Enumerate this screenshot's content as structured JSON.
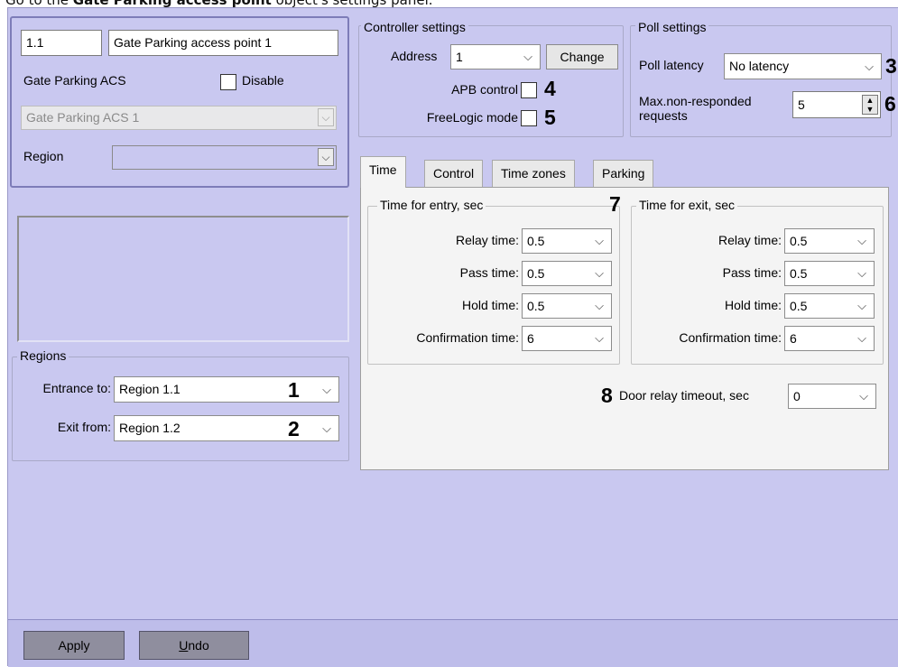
{
  "caption": {
    "prefix": "Go to the ",
    "bold": "Gate Parking access point",
    "suffix": " object's settings panel."
  },
  "object": {
    "id": "1.1",
    "name": "Gate Parking access point 1",
    "parent_label": "Gate Parking ACS",
    "disable_label": "Disable",
    "parent_value": "Gate Parking ACS 1",
    "region_label": "Region",
    "region_value": ""
  },
  "regions": {
    "legend": "Regions",
    "entrance_label": "Entrance to:",
    "entrance_value": "Region 1.1",
    "entrance_marker": "1",
    "exit_label": "Exit from:",
    "exit_value": "Region 1.2",
    "exit_marker": "2"
  },
  "controller": {
    "legend": "Controller settings",
    "address_label": "Address",
    "address_value": "1",
    "change_button": "Change",
    "apb_label": "APB control",
    "apb_marker": "4",
    "freelogic_label": "FreeLogic mode",
    "freelogic_marker": "5"
  },
  "poll": {
    "legend": "Poll settings",
    "latency_label": "Poll latency",
    "latency_value": "No latency",
    "latency_marker": "3",
    "max_label_line1": "Max.non-responded",
    "max_label_line2": "requests",
    "max_value": "5",
    "max_marker": "6"
  },
  "tabs": [
    "Time",
    "Control",
    "Time zones",
    "Parking"
  ],
  "time_tab": {
    "entry_legend": "Time for entry, sec",
    "exit_legend": "Time for exit, sec",
    "group_marker": "7",
    "relay_label": "Relay time:",
    "pass_label": "Pass time:",
    "hold_label": "Hold time:",
    "confirm_label": "Confirmation time:",
    "entry": {
      "relay": "0.5",
      "pass": "0.5",
      "hold": "0.5",
      "confirm": "6"
    },
    "exit": {
      "relay": "0.5",
      "pass": "0.5",
      "hold": "0.5",
      "confirm": "6"
    },
    "door_label": "Door relay timeout, sec",
    "door_value": "0",
    "door_marker": "8"
  },
  "footer": {
    "apply": "Apply",
    "undo_underlined": "U",
    "undo_rest": "ndo"
  },
  "colors": {
    "panel_bg": "#c9c8f0",
    "tab_page_bg": "#f4f4f4"
  }
}
